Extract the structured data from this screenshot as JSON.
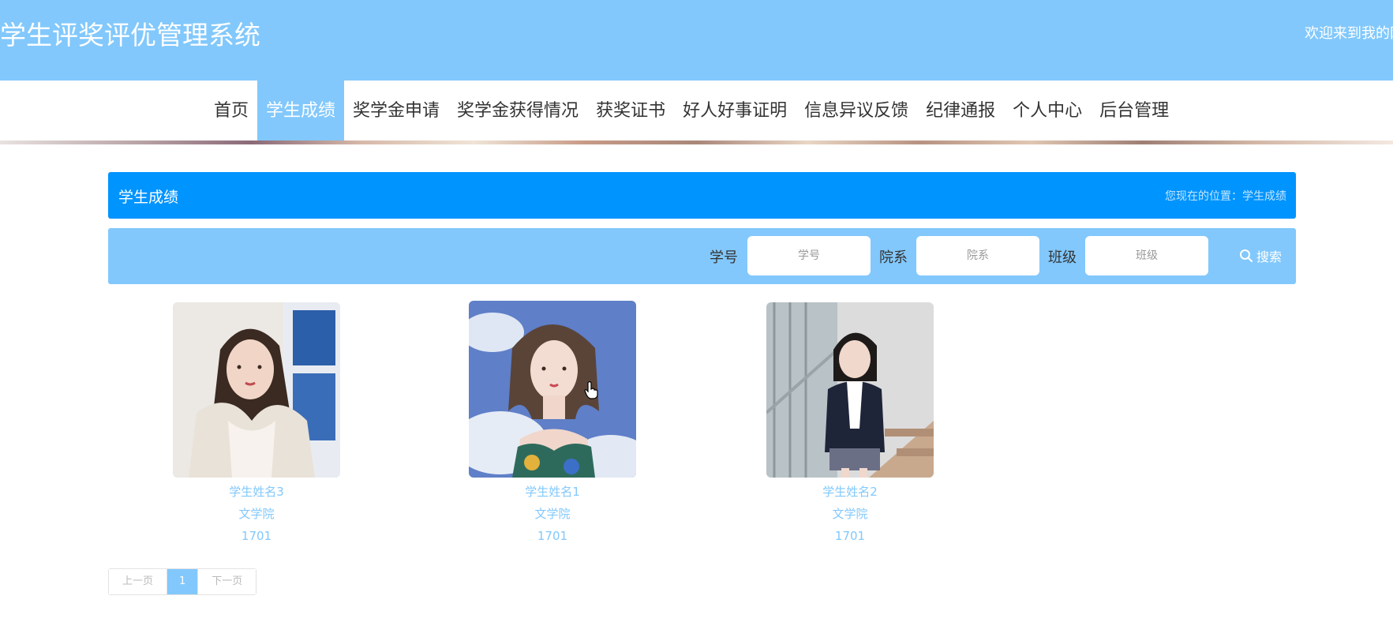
{
  "header": {
    "site_title": "学生评奖评优管理系统",
    "welcome": "欢迎来到我的网"
  },
  "nav": {
    "items": [
      {
        "label": "首页"
      },
      {
        "label": "学生成绩"
      },
      {
        "label": "奖学金申请"
      },
      {
        "label": "奖学金获得情况"
      },
      {
        "label": "获奖证书"
      },
      {
        "label": "好人好事证明"
      },
      {
        "label": "信息异议反馈"
      },
      {
        "label": "纪律通报"
      },
      {
        "label": "个人中心"
      },
      {
        "label": "后台管理"
      }
    ],
    "active": "学生成绩"
  },
  "section": {
    "title": "学生成绩",
    "location": "您现在的位置：学生成绩"
  },
  "search": {
    "student_id_label": "学号",
    "student_id_placeholder": "学号",
    "department_label": "院系",
    "department_placeholder": "院系",
    "class_label": "班级",
    "class_placeholder": "班级",
    "button_label": "搜索"
  },
  "students": [
    {
      "name": "学生姓名3",
      "department": "文学院",
      "class": "1701"
    },
    {
      "name": "学生姓名1",
      "department": "文学院",
      "class": "1701"
    },
    {
      "name": "学生姓名2",
      "department": "文学院",
      "class": "1701"
    }
  ],
  "pagination": {
    "prev": "上一页",
    "current": "1",
    "next": "下一页"
  },
  "colors": {
    "header_bg": "#82c8fc",
    "title_bar_bg": "#0094ff",
    "card_text": "#82c8fc"
  },
  "icons": {
    "search": "search-icon",
    "cursor": "hand-cursor-icon"
  }
}
